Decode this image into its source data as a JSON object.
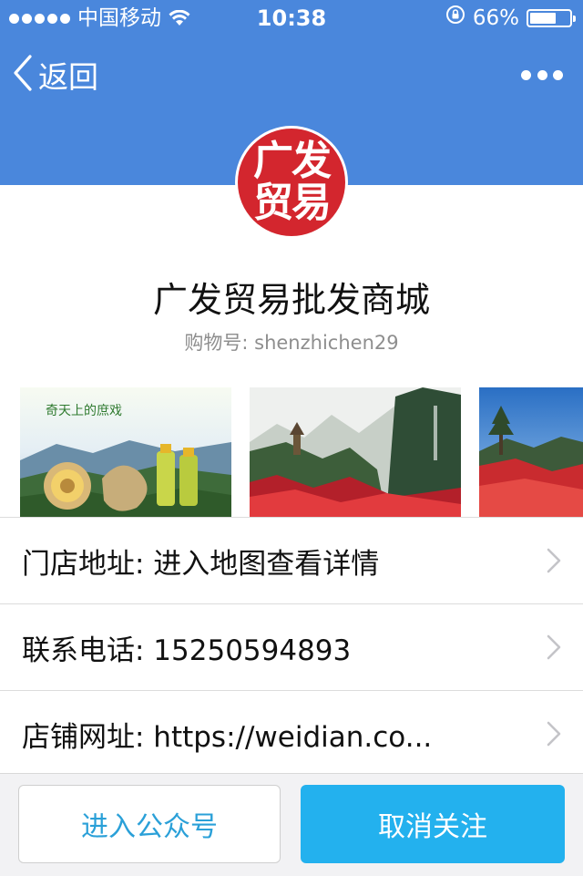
{
  "status_bar": {
    "carrier": "中国移动",
    "time": "10:38",
    "battery": "66%",
    "battery_level": 0.66,
    "icons": [
      "signal-dots-icon",
      "wifi-icon",
      "rotation-lock-icon",
      "battery-icon"
    ]
  },
  "nav": {
    "back_label": "返回",
    "back_icon": "chevron-left-icon",
    "more_icon": "more-dots-icon"
  },
  "colors": {
    "header_blue": "#4a87dc",
    "avatar_red": "#d3262e",
    "primary_button": "#23b1ee",
    "secondary_text": "#2aa0d8"
  },
  "profile": {
    "avatar_line1": "广发",
    "avatar_line2": "贸易",
    "name": "广发贸易批发商城",
    "shop_id": "购物号: shenzhichen29"
  },
  "gallery": {
    "photo1_caption": "奇天上的庶戏"
  },
  "info_rows": [
    {
      "label": "门店地址: 进入地图查看详情",
      "icon": "chevron-right-icon"
    },
    {
      "label": "联系电话: 15250594893",
      "icon": "chevron-right-icon"
    },
    {
      "label": "店铺网址: https://weidian.co...",
      "icon": "chevron-right-icon"
    }
  ],
  "actions": {
    "follow_account": "进入公众号",
    "unfollow": "取消关注"
  }
}
